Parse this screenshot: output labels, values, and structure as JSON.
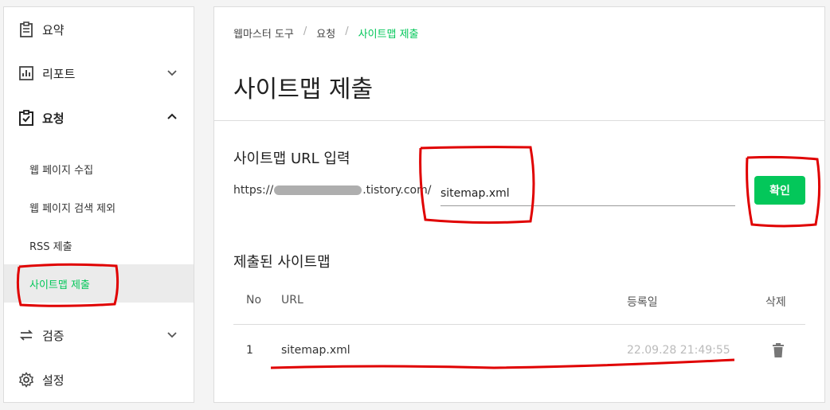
{
  "sidebar": {
    "items": [
      {
        "label": "요약"
      },
      {
        "label": "리포트"
      },
      {
        "label": "요청"
      },
      {
        "label": "검증"
      },
      {
        "label": "설정"
      }
    ],
    "sub_items": [
      {
        "label": "웹 페이지 수집"
      },
      {
        "label": "웹 페이지 검색 제외"
      },
      {
        "label": "RSS 제출"
      },
      {
        "label": "사이트맵 제출"
      }
    ]
  },
  "breadcrumb": {
    "items": [
      "웹마스터 도구",
      "요청",
      "사이트맵 제출"
    ],
    "separator": "/"
  },
  "page_title": "사이트맵 제출",
  "form": {
    "section_title": "사이트맵 URL 입력",
    "url_prefix_start": "https://",
    "url_prefix_end": ".tistory.com/",
    "input_value": "sitemap.xml",
    "confirm_label": "확인"
  },
  "submitted": {
    "section_title": "제출된 사이트맵",
    "columns": [
      "No",
      "URL",
      "등록일",
      "삭제"
    ],
    "rows": [
      {
        "no": "1",
        "url": "sitemap.xml",
        "date": "22.09.28 21:49:55"
      }
    ]
  },
  "colors": {
    "accent": "#03c75a",
    "annotation": "#e00000"
  }
}
